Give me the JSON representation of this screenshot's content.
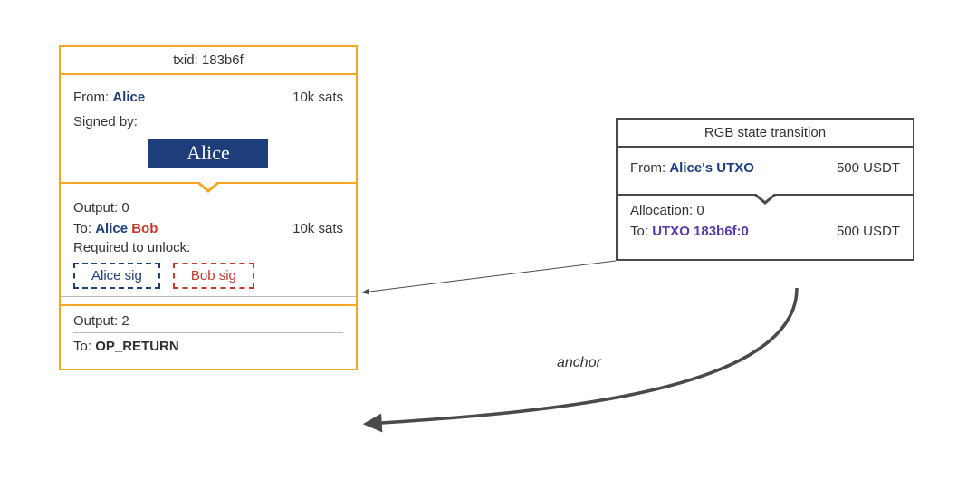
{
  "tx": {
    "title": "txid: 183b6f",
    "input": {
      "from_label": "From:",
      "from_value": "Alice",
      "amount": "10k sats",
      "signed_by_label": "Signed by:",
      "signature_badge": "Alice"
    },
    "output0": {
      "header": "Output: 0",
      "to_label": "To:",
      "to_alice": "Alice",
      "to_bob": "Bob",
      "amount": "10k sats",
      "required_label": "Required to unlock:",
      "alice_sig": "Alice sig",
      "bob_sig": "Bob sig"
    },
    "output2": {
      "header": "Output: 2",
      "to_label": "To:",
      "to_value": "OP_RETURN"
    }
  },
  "rgb": {
    "title": "RGB state transition",
    "input": {
      "from_label": "From:",
      "from_value": "Alice's UTXO",
      "amount": "500 USDT"
    },
    "alloc": {
      "header": "Allocation: 0",
      "to_label": "To:",
      "to_value": "UTXO 183b6f:0",
      "amount": "500 USDT"
    }
  },
  "anchor_label": "anchor",
  "colors": {
    "orange": "#f5a623",
    "navy": "#1e3e7b",
    "red": "#c0392b",
    "grey": "#4a4a4a",
    "purple": "#5a3aa8"
  }
}
